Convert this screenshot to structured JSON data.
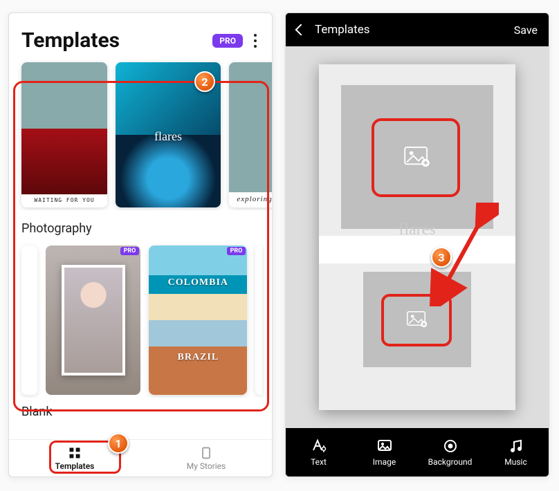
{
  "left": {
    "title": "Templates",
    "pro_badge": "PRO",
    "sections": {
      "photography": "Photography",
      "blank": "Blank"
    },
    "cards": {
      "waiting": "WAITING FOR YOU",
      "flares": "flares",
      "exploring": "exploring",
      "colombia": "COLOMBIA",
      "brazil": "BRAZIL",
      "mini_pro": "PRO"
    },
    "nav": {
      "templates": "Templates",
      "mystories": "My Stories"
    }
  },
  "right": {
    "header_title": "Templates",
    "save": "Save",
    "flares": "flares",
    "toolbar": {
      "text": "Text",
      "image": "Image",
      "background": "Background",
      "music": "Music"
    }
  },
  "callouts": {
    "c1": "1",
    "c2": "2",
    "c3": "3"
  }
}
